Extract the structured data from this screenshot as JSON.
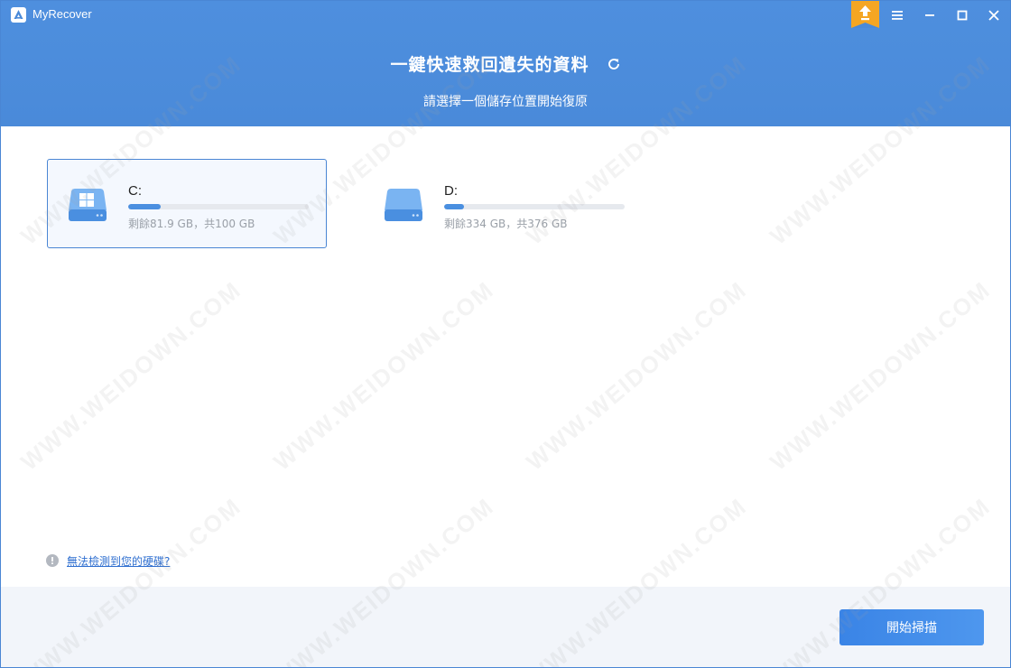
{
  "app": {
    "title": "MyRecover"
  },
  "header": {
    "headline": "一鍵快速救回遺失的資料",
    "subtitle": "請選擇一個儲存位置開始復原"
  },
  "drives": [
    {
      "letter": "C:",
      "info": "剩餘81.9 GB，共100 GB",
      "used_fraction": 0.18,
      "selected": true,
      "icon": "windows-drive-icon"
    },
    {
      "letter": "D:",
      "info": "剩餘334 GB，共376 GB",
      "used_fraction": 0.11,
      "selected": false,
      "icon": "drive-icon"
    }
  ],
  "help": {
    "link_text": "無法檢測到您的硬碟?"
  },
  "footer": {
    "scan_label": "開始掃描"
  },
  "watermark": {
    "text": "WWW.WEIDOWN.COM"
  },
  "colors": {
    "header_blue": "#4a8ad9",
    "accent": "#4a8fe0",
    "upgrade_orange": "#f5a623"
  }
}
